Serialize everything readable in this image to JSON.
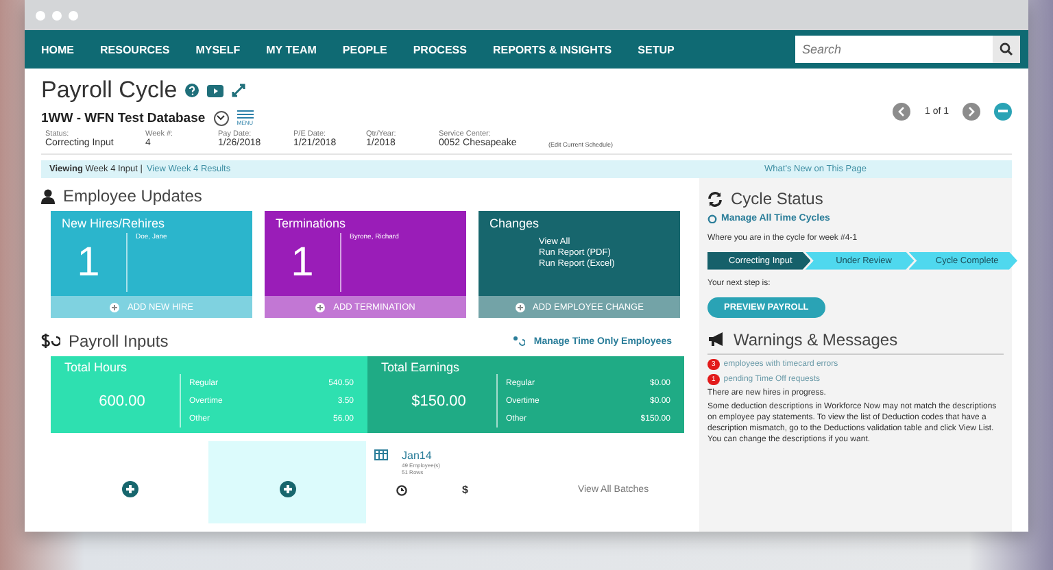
{
  "nav": {
    "items": [
      "HOME",
      "RESOURCES",
      "MYSELF",
      "MY TEAM",
      "PEOPLE",
      "PROCESS",
      "REPORTS & INSIGHTS",
      "SETUP"
    ],
    "search": {
      "placeholder": "Search"
    }
  },
  "header": {
    "title": "Payroll Cycle",
    "company": "1WW - WFN Test Database",
    "menu_label": "MENU",
    "pager": "1 of 1"
  },
  "info": [
    {
      "label": "Status:",
      "value": "Correcting Input"
    },
    {
      "label": "Week #:",
      "value": "4"
    },
    {
      "label": "Pay Date:",
      "value": "1/26/2018"
    },
    {
      "label": "P/E Date:",
      "value": "1/21/2018"
    },
    {
      "label": "Qtr/Year:",
      "value": "1/2018"
    },
    {
      "label": "Service Center:",
      "value": "0052  Chesapeake"
    }
  ],
  "edit_link": "(Edit Current Schedule)",
  "viewing_bar": {
    "current": "**Viewing** Week 4 Input |",
    "results_link": "View Week 4 Results",
    "whats_new": "What's New on This Page"
  },
  "employee_updates": {
    "title": "Employee Updates",
    "cards": [
      {
        "kind": "count",
        "title": "New Hires/Rehires",
        "count": "1",
        "names": [
          "Doe, Jane"
        ],
        "action": "ADD NEW HIRE",
        "color": "#2bb5cc"
      },
      {
        "kind": "count",
        "title": "Terminations",
        "count": "1",
        "names": [
          "Byrone, Richard"
        ],
        "action": "ADD TERMINATION",
        "color": "#9a1db8"
      },
      {
        "kind": "links",
        "title": "Changes",
        "links": [
          "View All",
          "Run Report (PDF)",
          "Run Report (Excel)"
        ],
        "action": "ADD EMPLOYEE CHANGE",
        "color": "#17666d"
      }
    ]
  },
  "payroll_inputs": {
    "title": "Payroll Inputs",
    "manage_link": "Manage Time Only Employees",
    "totals": [
      {
        "title": "Total Hours",
        "total": "600.00",
        "rows": [
          {
            "label": "Regular",
            "value": "540.50"
          },
          {
            "label": "Overtime",
            "value": "3.50"
          },
          {
            "label": "Other",
            "value": "56.00"
          }
        ],
        "color": "#2ee0b0"
      },
      {
        "title": "Total Earnings",
        "total": "$150.00",
        "rows": [
          {
            "label": "Regular",
            "value": "$0.00"
          },
          {
            "label": "Overtime",
            "value": "$0.00"
          },
          {
            "label": "Other",
            "value": "$150.00"
          }
        ],
        "color": "#1fab85"
      }
    ],
    "batch": {
      "name": "Jan14",
      "employees": "49 Employee(s)",
      "rows": "51 Rows",
      "currency": "$",
      "view_all": "View All Batches"
    }
  },
  "cycle_status": {
    "title": "Cycle Status",
    "manage_link": "Manage All Time Cycles",
    "prompt": "Where you are in the cycle for week #4-1",
    "steps": [
      {
        "label": "Correcting Input",
        "selected": true
      },
      {
        "label": "Under Review",
        "selected": false
      },
      {
        "label": "Cycle Complete",
        "selected": false
      }
    ],
    "next_label": "Your next step is:",
    "button": "PREVIEW PAYROLL"
  },
  "warnings": {
    "title": "Warnings & Messages",
    "alerts": [
      {
        "count": "3",
        "text": "employees with timecard errors"
      },
      {
        "count": "1",
        "text": "pending Time Off requests"
      }
    ],
    "messages": [
      "There are new hires in progress.",
      "Some deduction descriptions in Workforce Now may not match the descriptions on employee pay statements. To view the list of Deduction codes that have a description mismatch, go to the Deductions validation table and click View List. You can change the descriptions if you want."
    ]
  }
}
